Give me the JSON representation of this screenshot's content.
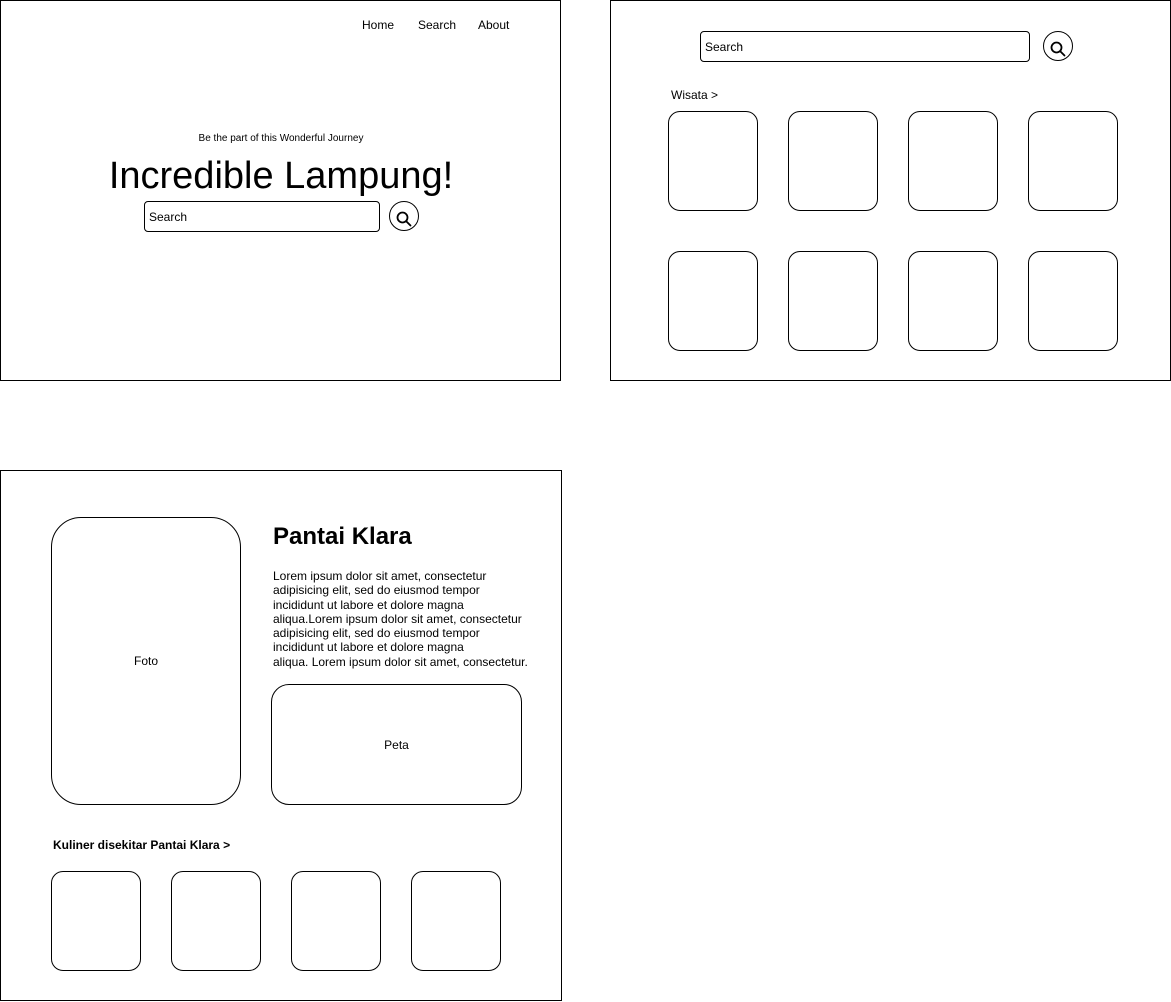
{
  "home": {
    "nav": [
      "Home",
      "Search",
      "About"
    ],
    "tagline": "Be the part of this Wonderful Journey",
    "title": "Incredible Lampung!",
    "search_placeholder": "Search"
  },
  "search_page": {
    "search_placeholder": "Search",
    "section_label": "Wisata >",
    "card_count": 8
  },
  "detail": {
    "photo_label": "Foto",
    "title": "Pantai Klara",
    "description": "Lorem ipsum dolor sit amet, consectetur\nadipisicing elit, sed do eiusmod tempor\nincididunt ut labore et dolore magna\naliqua.Lorem ipsum dolor sit amet, consectetur\nadipisicing elit, sed do eiusmod tempor\nincididunt ut labore et dolore magna\naliqua. Lorem ipsum dolor sit amet, consectetur.",
    "map_label": "Peta",
    "nearby_label": "Kuliner disekitar Pantai Klara >",
    "nearby_count": 4
  },
  "icons": {
    "search": "search-icon"
  }
}
